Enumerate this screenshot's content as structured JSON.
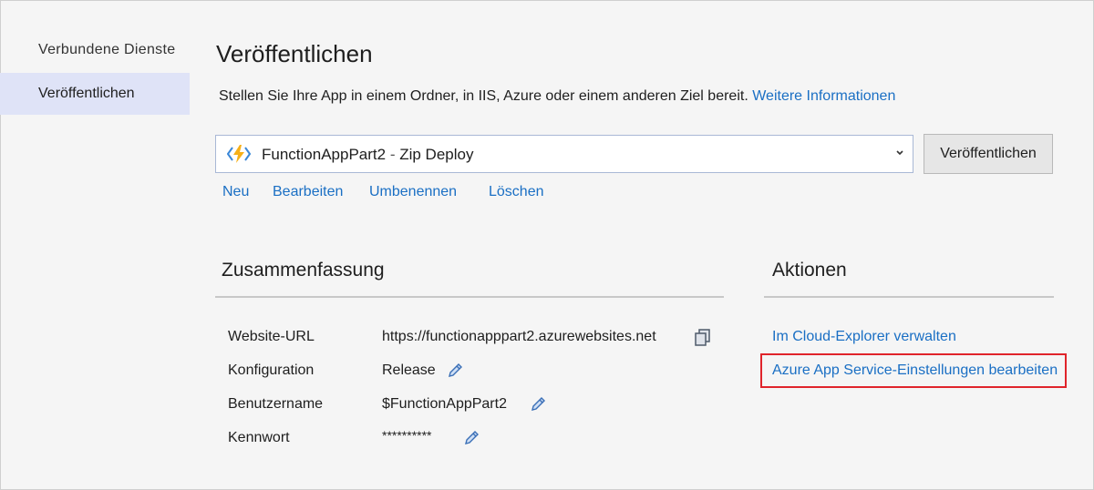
{
  "sidebar": {
    "items": [
      {
        "label": "Verbundene Dienste"
      },
      {
        "label": "Veröffentlichen"
      }
    ]
  },
  "main": {
    "title": "Veröffentlichen",
    "description": "Stellen Sie Ihre App in einem Ordner, in IIS, Azure oder einem anderen Ziel bereit.",
    "more_info_link": "Weitere Informationen",
    "profile": {
      "name": "FunctionAppPart2",
      "separator": " - ",
      "method": "Zip Deploy",
      "icon": "azure-functions-icon"
    },
    "publish_button": "Veröffentlichen",
    "profile_actions": [
      "Neu",
      "Bearbeiten",
      "Umbenennen",
      "Löschen"
    ]
  },
  "summary": {
    "heading": "Zusammenfassung",
    "rows": [
      {
        "label": "Website-URL",
        "value": "https://functionapppart2.azurewebsites.net",
        "icon": "copy-icon"
      },
      {
        "label": "Konfiguration",
        "value": "Release",
        "icon": "edit-pencil-icon"
      },
      {
        "label": "Benutzername",
        "value": "$FunctionAppPart2",
        "icon": "edit-pencil-icon"
      },
      {
        "label": "Kennwort",
        "value": "**********",
        "icon": "edit-pencil-icon"
      }
    ]
  },
  "actions": {
    "heading": "Aktionen",
    "items": [
      {
        "label": "Im Cloud-Explorer verwalten"
      },
      {
        "label": "Azure App Service-Einstellungen bearbeiten",
        "highlighted": true
      }
    ]
  },
  "colors": {
    "link": "#1a6fc4",
    "sidebar_active": "#dfe3f7",
    "highlight_border": "#e0242b",
    "azure_functions": "#f6b019"
  }
}
